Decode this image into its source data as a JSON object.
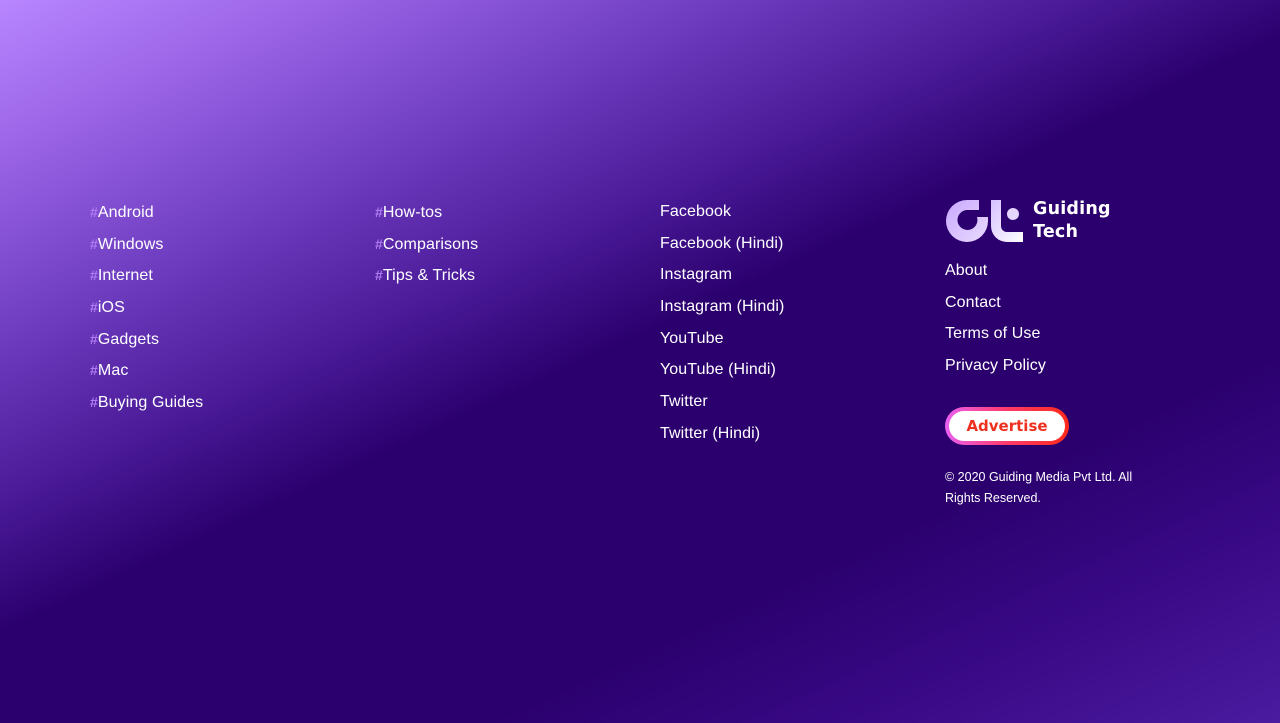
{
  "topics": {
    "hash_symbol": "#",
    "items": [
      "Android",
      "Windows",
      "Internet",
      "iOS",
      "Gadgets",
      "Mac",
      "Buying Guides"
    ]
  },
  "content_types": {
    "items": [
      "How-tos",
      "Comparisons",
      "Tips & Tricks"
    ]
  },
  "social": {
    "items": [
      "Facebook",
      "Facebook (Hindi)",
      "Instagram",
      "Instagram (Hindi)",
      "YouTube",
      "YouTube (Hindi)",
      "Twitter",
      "Twitter (Hindi)"
    ]
  },
  "brand": {
    "name_line1": "Guiding",
    "name_line2": "Tech",
    "links": [
      "About",
      "Contact",
      "Terms of Use",
      "Privacy Policy"
    ],
    "advertise_label": "Advertise",
    "copyright": "© 2020 Guiding Media Pvt Ltd. All Rights Reserved."
  },
  "colors": {
    "background_dark": "#2b006e",
    "background_light": "#b886ff",
    "hash_accent": "#b07cf2",
    "advertise_text": "#f0301e"
  },
  "icons": {
    "logo": "guiding-tech-gt-logo-icon"
  }
}
